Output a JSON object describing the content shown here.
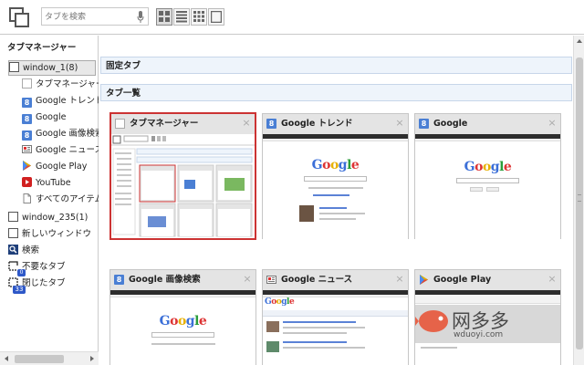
{
  "search": {
    "placeholder": "タブを検索"
  },
  "sidebar": {
    "title": "タブマネージャー",
    "items": [
      {
        "label": "window_1(8)",
        "icon": "checkbox-icon"
      },
      {
        "label": "タブマネージャー",
        "icon": "blank-page-icon"
      },
      {
        "label": "Google トレンド",
        "icon": "google-icon"
      },
      {
        "label": "Google",
        "icon": "google-icon"
      },
      {
        "label": "Google 画像検索",
        "icon": "google-icon"
      },
      {
        "label": "Google ニュース",
        "icon": "news-icon"
      },
      {
        "label": "Google Play",
        "icon": "play-icon"
      },
      {
        "label": "YouTube",
        "icon": "youtube-icon"
      },
      {
        "label": "すべてのアイテム",
        "icon": "document-icon"
      },
      {
        "label": "window_235(1)",
        "icon": "checkbox-icon"
      },
      {
        "label": "新しいウィンドウ",
        "icon": "checkbox-icon"
      },
      {
        "label": "検索",
        "icon": "search-icon"
      },
      {
        "label": "不要なタブ",
        "icon": "unneeded-tabs-icon"
      },
      {
        "label": "閉じたタブ",
        "icon": "closed-tabs-icon",
        "badge": "33"
      }
    ],
    "unneeded_badge": "0"
  },
  "main": {
    "pinned_header": "固定タブ",
    "list_header": "タブ一覧",
    "cards": [
      {
        "title": "タブマネージャー",
        "icon": "blank-page-icon",
        "selected": true
      },
      {
        "title": "Google トレンド",
        "icon": "google-icon"
      },
      {
        "title": "Google",
        "icon": "google-icon"
      },
      {
        "title": "Google 画像検索",
        "icon": "google-icon"
      },
      {
        "title": "Google ニュース",
        "icon": "news-icon"
      },
      {
        "title": "Google Play",
        "icon": "play-icon"
      }
    ],
    "thumb_logo": "Google",
    "close_glyph": "×"
  },
  "watermark": {
    "text": "网多多",
    "sub": "wduoyi.com"
  },
  "colors": {
    "selected_border": "#cc3333",
    "header_bg": "#eef4fb",
    "accent_blue": "#4a7fd4"
  }
}
